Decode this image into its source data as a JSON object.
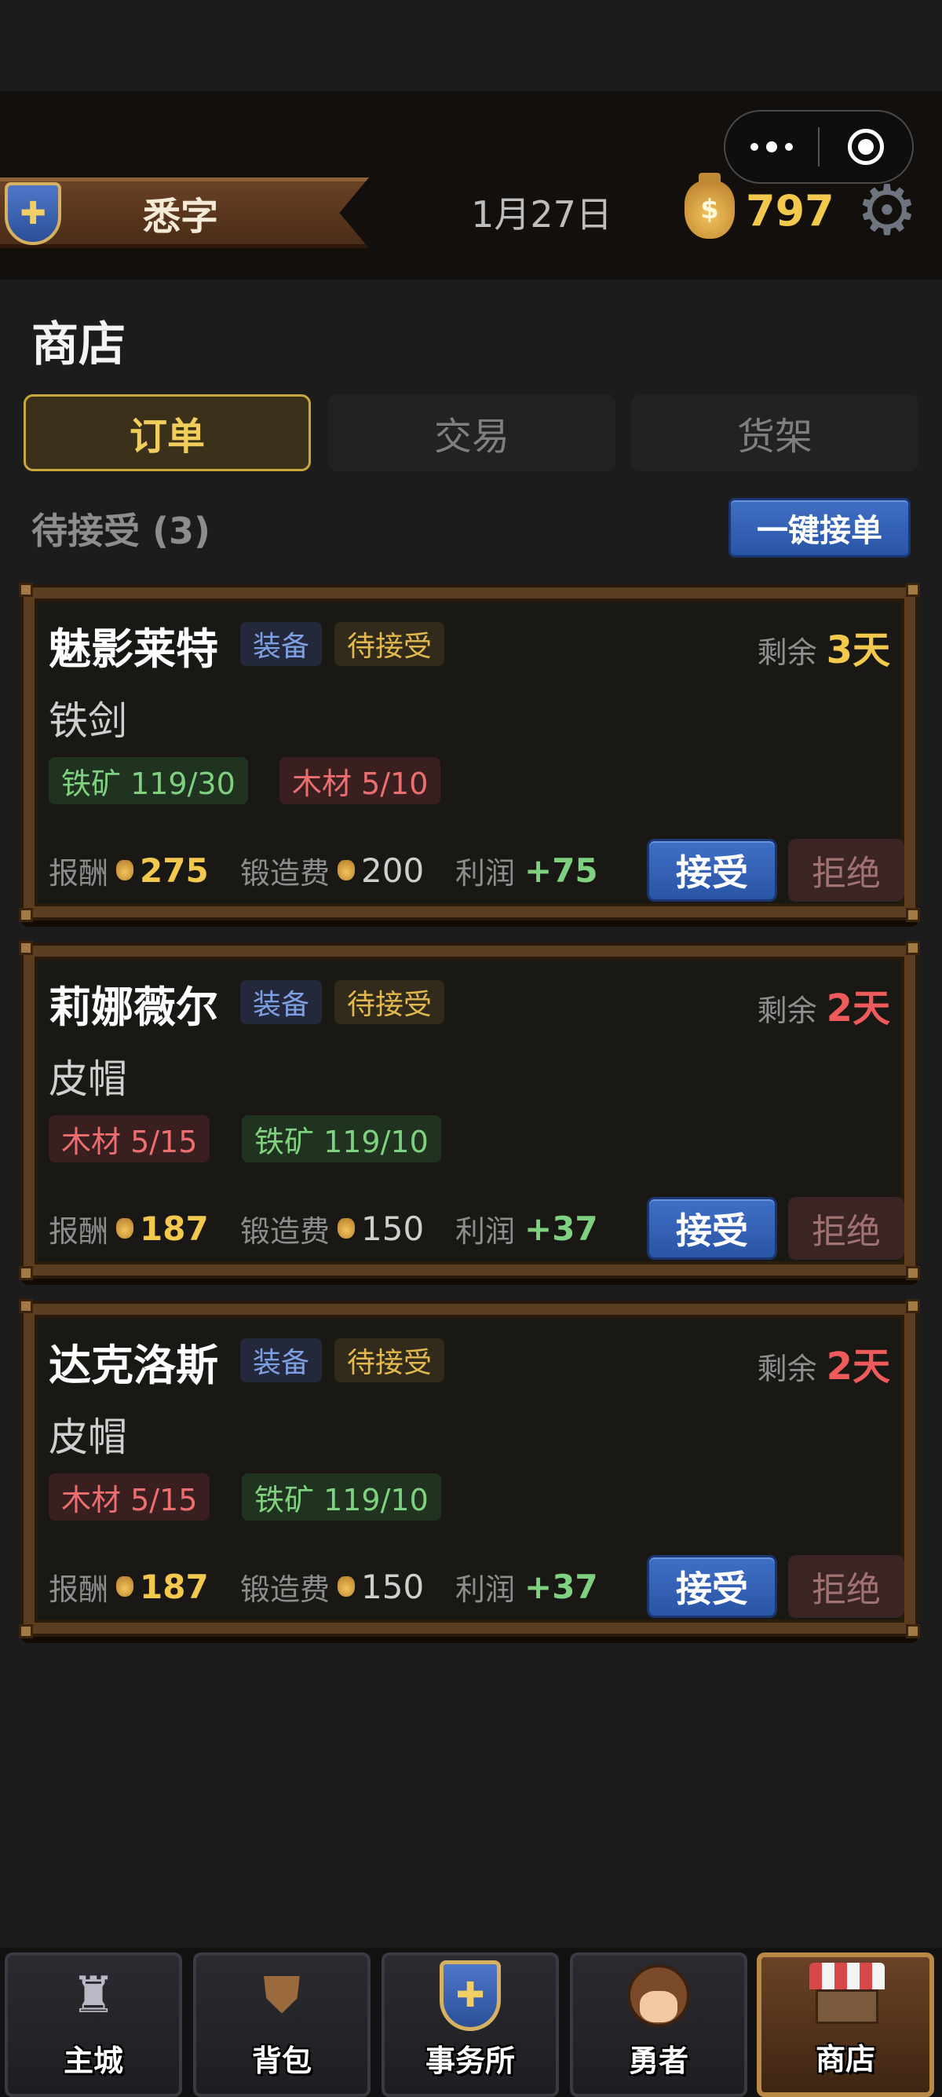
{
  "header": {
    "guild_name": "悉字",
    "date": "1月27日",
    "gold": "797",
    "coin_symbol": "$",
    "shield_symbol": "✚"
  },
  "page": {
    "title": "商店",
    "tabs": [
      {
        "label": "订单",
        "active": true
      },
      {
        "label": "交易",
        "active": false
      },
      {
        "label": "货架",
        "active": false
      }
    ],
    "pending_label": "待接受 (3)",
    "accept_all_label": "一键接单"
  },
  "orders": [
    {
      "customer": "魅影莱特",
      "type_tag": "装备",
      "status_tag": "待接受",
      "remain_label": "剩余",
      "remain_value": "3天",
      "item": "铁剑",
      "materials": [
        {
          "text": "铁矿 119/30",
          "status": "ok"
        },
        {
          "text": "木材 5/10",
          "status": "short"
        }
      ],
      "reward_label": "报酬",
      "reward": "275",
      "fee_label": "锻造费",
      "fee": "200",
      "profit_label": "利润",
      "profit": "+75",
      "accept_label": "接受",
      "reject_label": "拒绝"
    },
    {
      "customer": "莉娜薇尔",
      "type_tag": "装备",
      "status_tag": "待接受",
      "remain_label": "剩余",
      "remain_value": "2天",
      "item": "皮帽",
      "materials": [
        {
          "text": "木材 5/15",
          "status": "short"
        },
        {
          "text": "铁矿 119/10",
          "status": "ok"
        }
      ],
      "reward_label": "报酬",
      "reward": "187",
      "fee_label": "锻造费",
      "fee": "150",
      "profit_label": "利润",
      "profit": "+37",
      "accept_label": "接受",
      "reject_label": "拒绝"
    },
    {
      "customer": "达克洛斯",
      "type_tag": "装备",
      "status_tag": "待接受",
      "remain_label": "剩余",
      "remain_value": "2天",
      "item": "皮帽",
      "materials": [
        {
          "text": "木材 5/15",
          "status": "short"
        },
        {
          "text": "铁矿 119/10",
          "status": "ok"
        }
      ],
      "reward_label": "报酬",
      "reward": "187",
      "fee_label": "锻造费",
      "fee": "150",
      "profit_label": "利润",
      "profit": "+37",
      "accept_label": "接受",
      "reject_label": "拒绝"
    }
  ],
  "bottom_nav": [
    {
      "label": "主城",
      "icon": "castle-icon"
    },
    {
      "label": "背包",
      "icon": "backpack-icon"
    },
    {
      "label": "事务所",
      "icon": "shield-icon"
    },
    {
      "label": "勇者",
      "icon": "hero-icon"
    },
    {
      "label": "商店",
      "icon": "shop-icon",
      "active": true
    }
  ],
  "colors": {
    "accent_gold": "#f2c94c",
    "accept_blue": "#2a55a6",
    "danger_red": "#ef5b5b",
    "ok_green": "#7fd07f"
  }
}
